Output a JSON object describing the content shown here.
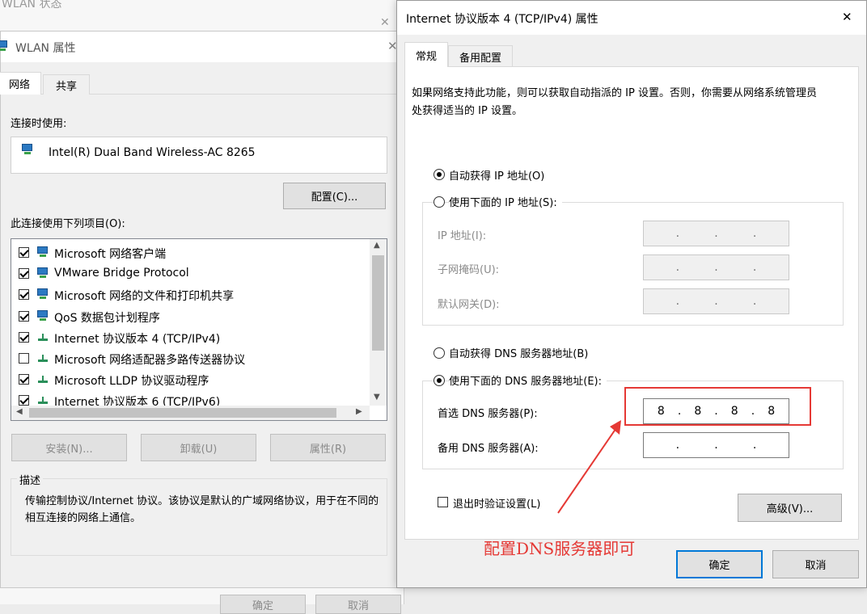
{
  "background_window": {
    "title": "WLAN 状态",
    "ok_label": "确定",
    "cancel_label": "取消"
  },
  "wlan_props": {
    "title": "WLAN 属性",
    "tabs": [
      "网络",
      "共享"
    ],
    "connect_using_label": "连接时使用:",
    "adapter_name": "Intel(R) Dual Band Wireless-AC 8265",
    "configure_label": "配置(C)...",
    "items_label": "此连接使用下列项目(O):",
    "items": [
      {
        "label": "Microsoft 网络客户端",
        "checked": true,
        "icon": "network-client-icon"
      },
      {
        "label": "VMware Bridge Protocol",
        "checked": true,
        "icon": "network-client-icon"
      },
      {
        "label": "Microsoft 网络的文件和打印机共享",
        "checked": true,
        "icon": "network-client-icon"
      },
      {
        "label": "QoS 数据包计划程序",
        "checked": true,
        "icon": "network-client-icon"
      },
      {
        "label": "Internet 协议版本 4 (TCP/IPv4)",
        "checked": true,
        "icon": "protocol-icon"
      },
      {
        "label": "Microsoft 网络适配器多路传送器协议",
        "checked": false,
        "icon": "protocol-icon"
      },
      {
        "label": "Microsoft LLDP 协议驱动程序",
        "checked": true,
        "icon": "protocol-icon"
      },
      {
        "label": "Internet 协议版本 6 (TCP/IPv6)",
        "checked": true,
        "icon": "protocol-icon"
      }
    ],
    "install_label": "安装(N)...",
    "uninstall_label": "卸载(U)",
    "properties_label": "属性(R)",
    "description_title": "描述",
    "description_text": "传输控制协议/Internet 协议。该协议是默认的广域网络协议，用于在不同的相互连接的网络上通信。"
  },
  "ipv4_props": {
    "title": "Internet 协议版本 4 (TCP/IPv4) 属性",
    "tabs": [
      "常规",
      "备用配置"
    ],
    "intro_text": "如果网络支持此功能，则可以获取自动指派的 IP 设置。否则，你需要从网络系统管理员处获得适当的 IP 设置。",
    "auto_ip_label": "自动获得 IP 地址(O)",
    "manual_ip_label": "使用下面的 IP 地址(S):",
    "ip_address_label": "IP 地址(I):",
    "subnet_mask_label": "子网掩码(U):",
    "gateway_label": "默认网关(D):",
    "auto_dns_label": "自动获得 DNS 服务器地址(B)",
    "manual_dns_label": "使用下面的 DNS 服务器地址(E):",
    "preferred_dns_label": "首选 DNS 服务器(P):",
    "preferred_dns_octets": [
      "8",
      "8",
      "8",
      "8"
    ],
    "alternate_dns_label": "备用 DNS 服务器(A):",
    "validate_label": "退出时验证设置(L)",
    "advanced_label": "高级(V)...",
    "ok_label": "确定",
    "cancel_label": "取消",
    "selected_ip_mode": "auto",
    "selected_dns_mode": "manual",
    "validate_checked": false
  },
  "annotation": {
    "text": "配置DNS服务器即可",
    "color": "#e53935"
  }
}
